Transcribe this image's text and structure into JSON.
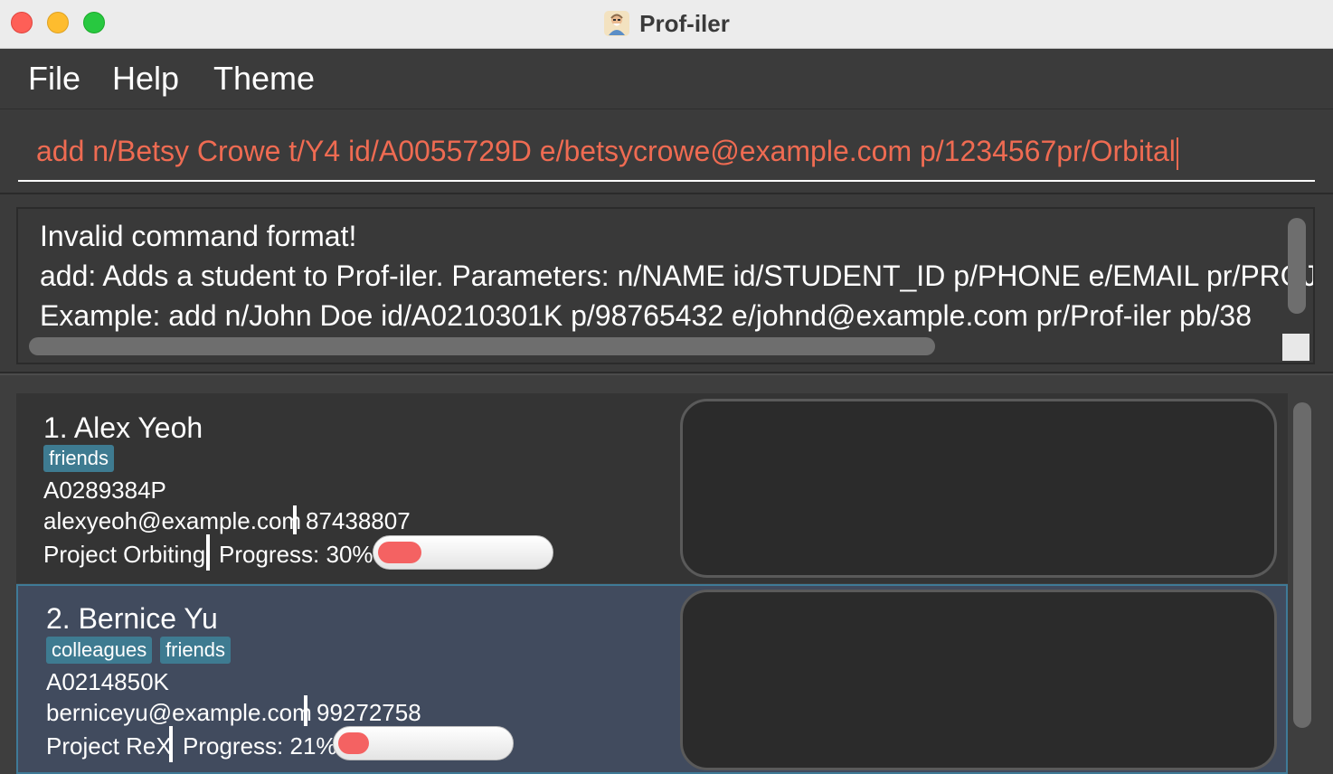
{
  "window": {
    "title": "Prof-iler",
    "app_icon": "professor-avatar-icon"
  },
  "menu": {
    "items": [
      "File",
      "Help",
      "Theme"
    ]
  },
  "command": {
    "value": "add n/Betsy Crowe t/Y4 id/A0055729D e/betsycrowe@example.com p/1234567pr/Orbital"
  },
  "result": {
    "lines": [
      "Invalid command format!",
      "add: Adds a student to Prof-iler. Parameters: n/NAME id/STUDENT_ID p/PHONE e/EMAIL pr/PROJECT_NAME pb/PROGRESS",
      "Example: add n/John Doe id/A0210301K p/98765432 e/johnd@example.com pr/Prof-iler pb/38"
    ]
  },
  "students": [
    {
      "name": "1. Alex Yeoh",
      "tags": [
        "friends"
      ],
      "student_id": "A0289384P",
      "email": "alexyeoh@example.com",
      "phone": "87438807",
      "project": "Project Orbiting",
      "progress_label": "Progress: 30%",
      "progress": 0.3,
      "selected": false
    },
    {
      "name": "2. Bernice Yu",
      "tags": [
        "colleagues",
        "friends"
      ],
      "student_id": "A0214850K",
      "email": "berniceyu@example.com",
      "phone": "99272758",
      "project": "Project ReX",
      "progress_label": "Progress: 21%",
      "progress": 0.21,
      "selected": true
    }
  ],
  "colors": {
    "command_text": "#ef6b52",
    "tag_bg": "#3e7b91",
    "progress_fill": "#f46262",
    "selected_card_bg": "#414b5e",
    "selected_card_border": "#3f7a97"
  }
}
